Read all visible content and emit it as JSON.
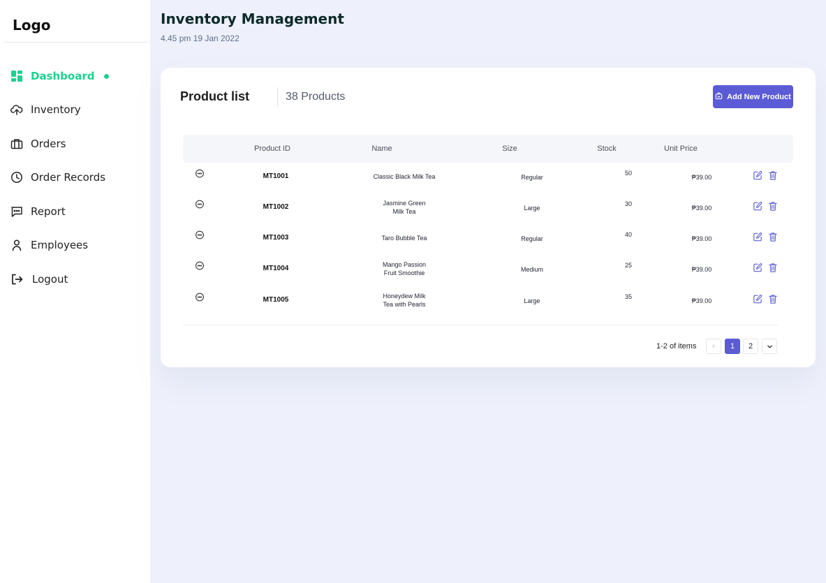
{
  "sidebar": {
    "logo": "Logo",
    "items": [
      {
        "label": "Dashboard",
        "icon": "dashboard-grid-icon",
        "active": true
      },
      {
        "label": "Inventory",
        "icon": "upload-icon"
      },
      {
        "label": "Orders",
        "icon": "briefcase-icon"
      },
      {
        "label": "Order Records",
        "icon": "clock-icon"
      },
      {
        "label": "Report",
        "icon": "message-icon"
      },
      {
        "label": "Employees",
        "icon": "user-icon"
      },
      {
        "label": "Logout",
        "icon": "logout-icon"
      }
    ]
  },
  "header": {
    "title": "Inventory Management",
    "datetime": "4.45 pm 19 Jan 2022"
  },
  "card": {
    "title": "Product list",
    "count": "38 Products",
    "add_button": "Add New Product"
  },
  "table": {
    "columns": [
      "Product ID",
      "Name",
      "Size",
      "Stock",
      "Unit Price"
    ],
    "rows": [
      {
        "id": "MT1001",
        "name": [
          "Classic Black Milk Tea"
        ],
        "size": "Regular",
        "stock": "50",
        "price": "₱39.00"
      },
      {
        "id": "MT1002",
        "name": [
          "Jasmine Green",
          "Milk Tea"
        ],
        "size": "Large",
        "stock": "30",
        "price": "₱39.00"
      },
      {
        "id": "MT1003",
        "name": [
          "Taro Bubble Tea"
        ],
        "size": "Regular",
        "stock": "40",
        "price": "₱39.00"
      },
      {
        "id": "MT1004",
        "name": [
          "Mango Passion",
          "Fruit Smoothie"
        ],
        "size": "Medium",
        "stock": "25",
        "price": "₱39.00"
      },
      {
        "id": "MT1005",
        "name": [
          "Honeydew Milk",
          "Tea with Pearls"
        ],
        "size": "Large",
        "stock": "35",
        "price": "₱39.00"
      }
    ]
  },
  "pagination": {
    "info": "1-2 of items",
    "prev": "‹",
    "pages": [
      "1",
      "2"
    ],
    "current": "1",
    "next": "⌄"
  },
  "colors": {
    "accent": "#5b5bd6",
    "active_nav": "#1fd18f",
    "background": "#eef1fb"
  }
}
